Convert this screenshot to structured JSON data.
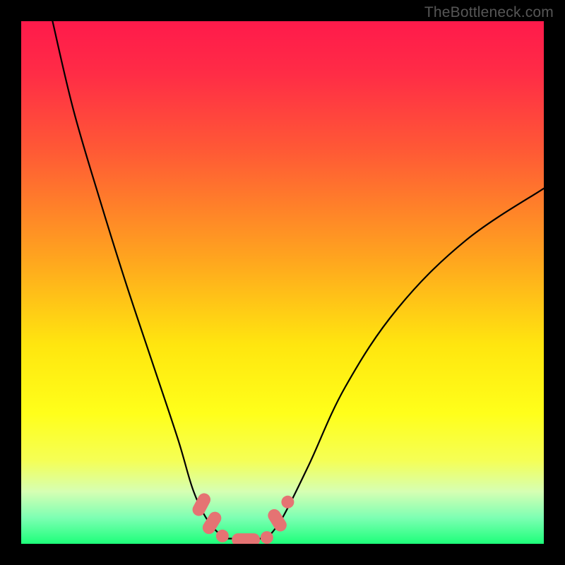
{
  "watermark": "TheBottleneck.com",
  "chart_data": {
    "type": "line",
    "title": "",
    "xlabel": "",
    "ylabel": "",
    "xlim": [
      0,
      100
    ],
    "ylim": [
      0,
      100
    ],
    "grid": false,
    "gradient_stops": [
      {
        "pos": 0.0,
        "color": "#ff1a4b"
      },
      {
        "pos": 0.1,
        "color": "#ff2c46"
      },
      {
        "pos": 0.25,
        "color": "#ff5a35"
      },
      {
        "pos": 0.45,
        "color": "#ffa31f"
      },
      {
        "pos": 0.62,
        "color": "#ffe60f"
      },
      {
        "pos": 0.75,
        "color": "#ffff1a"
      },
      {
        "pos": 0.84,
        "color": "#f5ff55"
      },
      {
        "pos": 0.9,
        "color": "#d6ffb3"
      },
      {
        "pos": 0.95,
        "color": "#7dffb3"
      },
      {
        "pos": 1.0,
        "color": "#1dff7a"
      }
    ],
    "series": [
      {
        "name": "left-curve",
        "color": "#000000",
        "values": [
          {
            "x": 6,
            "y": 100
          },
          {
            "x": 10,
            "y": 83
          },
          {
            "x": 15,
            "y": 66
          },
          {
            "x": 20,
            "y": 50
          },
          {
            "x": 25,
            "y": 35
          },
          {
            "x": 30,
            "y": 20
          },
          {
            "x": 33,
            "y": 10
          },
          {
            "x": 36,
            "y": 4
          },
          {
            "x": 39,
            "y": 1
          }
        ]
      },
      {
        "name": "valley-floor",
        "color": "#000000",
        "values": [
          {
            "x": 39,
            "y": 1
          },
          {
            "x": 47,
            "y": 1
          }
        ]
      },
      {
        "name": "right-curve",
        "color": "#000000",
        "values": [
          {
            "x": 47,
            "y": 1
          },
          {
            "x": 50,
            "y": 5
          },
          {
            "x": 55,
            "y": 15
          },
          {
            "x": 62,
            "y": 30
          },
          {
            "x": 72,
            "y": 45
          },
          {
            "x": 85,
            "y": 58
          },
          {
            "x": 100,
            "y": 68
          }
        ]
      }
    ],
    "markers": [
      {
        "x": 34.5,
        "y": 7.5,
        "color": "#e57373",
        "shape": "pill-diag",
        "angle": -62
      },
      {
        "x": 36.5,
        "y": 4.0,
        "color": "#e57373",
        "shape": "pill-diag",
        "angle": -58
      },
      {
        "x": 38.5,
        "y": 1.5,
        "color": "#e57373",
        "shape": "dot"
      },
      {
        "x": 43.0,
        "y": 0.8,
        "color": "#e57373",
        "shape": "pill-horiz"
      },
      {
        "x": 47.0,
        "y": 1.2,
        "color": "#e57373",
        "shape": "dot"
      },
      {
        "x": 49.0,
        "y": 4.5,
        "color": "#e57373",
        "shape": "pill-diag",
        "angle": 58
      },
      {
        "x": 51.0,
        "y": 8.0,
        "color": "#e57373",
        "shape": "dot"
      }
    ]
  }
}
